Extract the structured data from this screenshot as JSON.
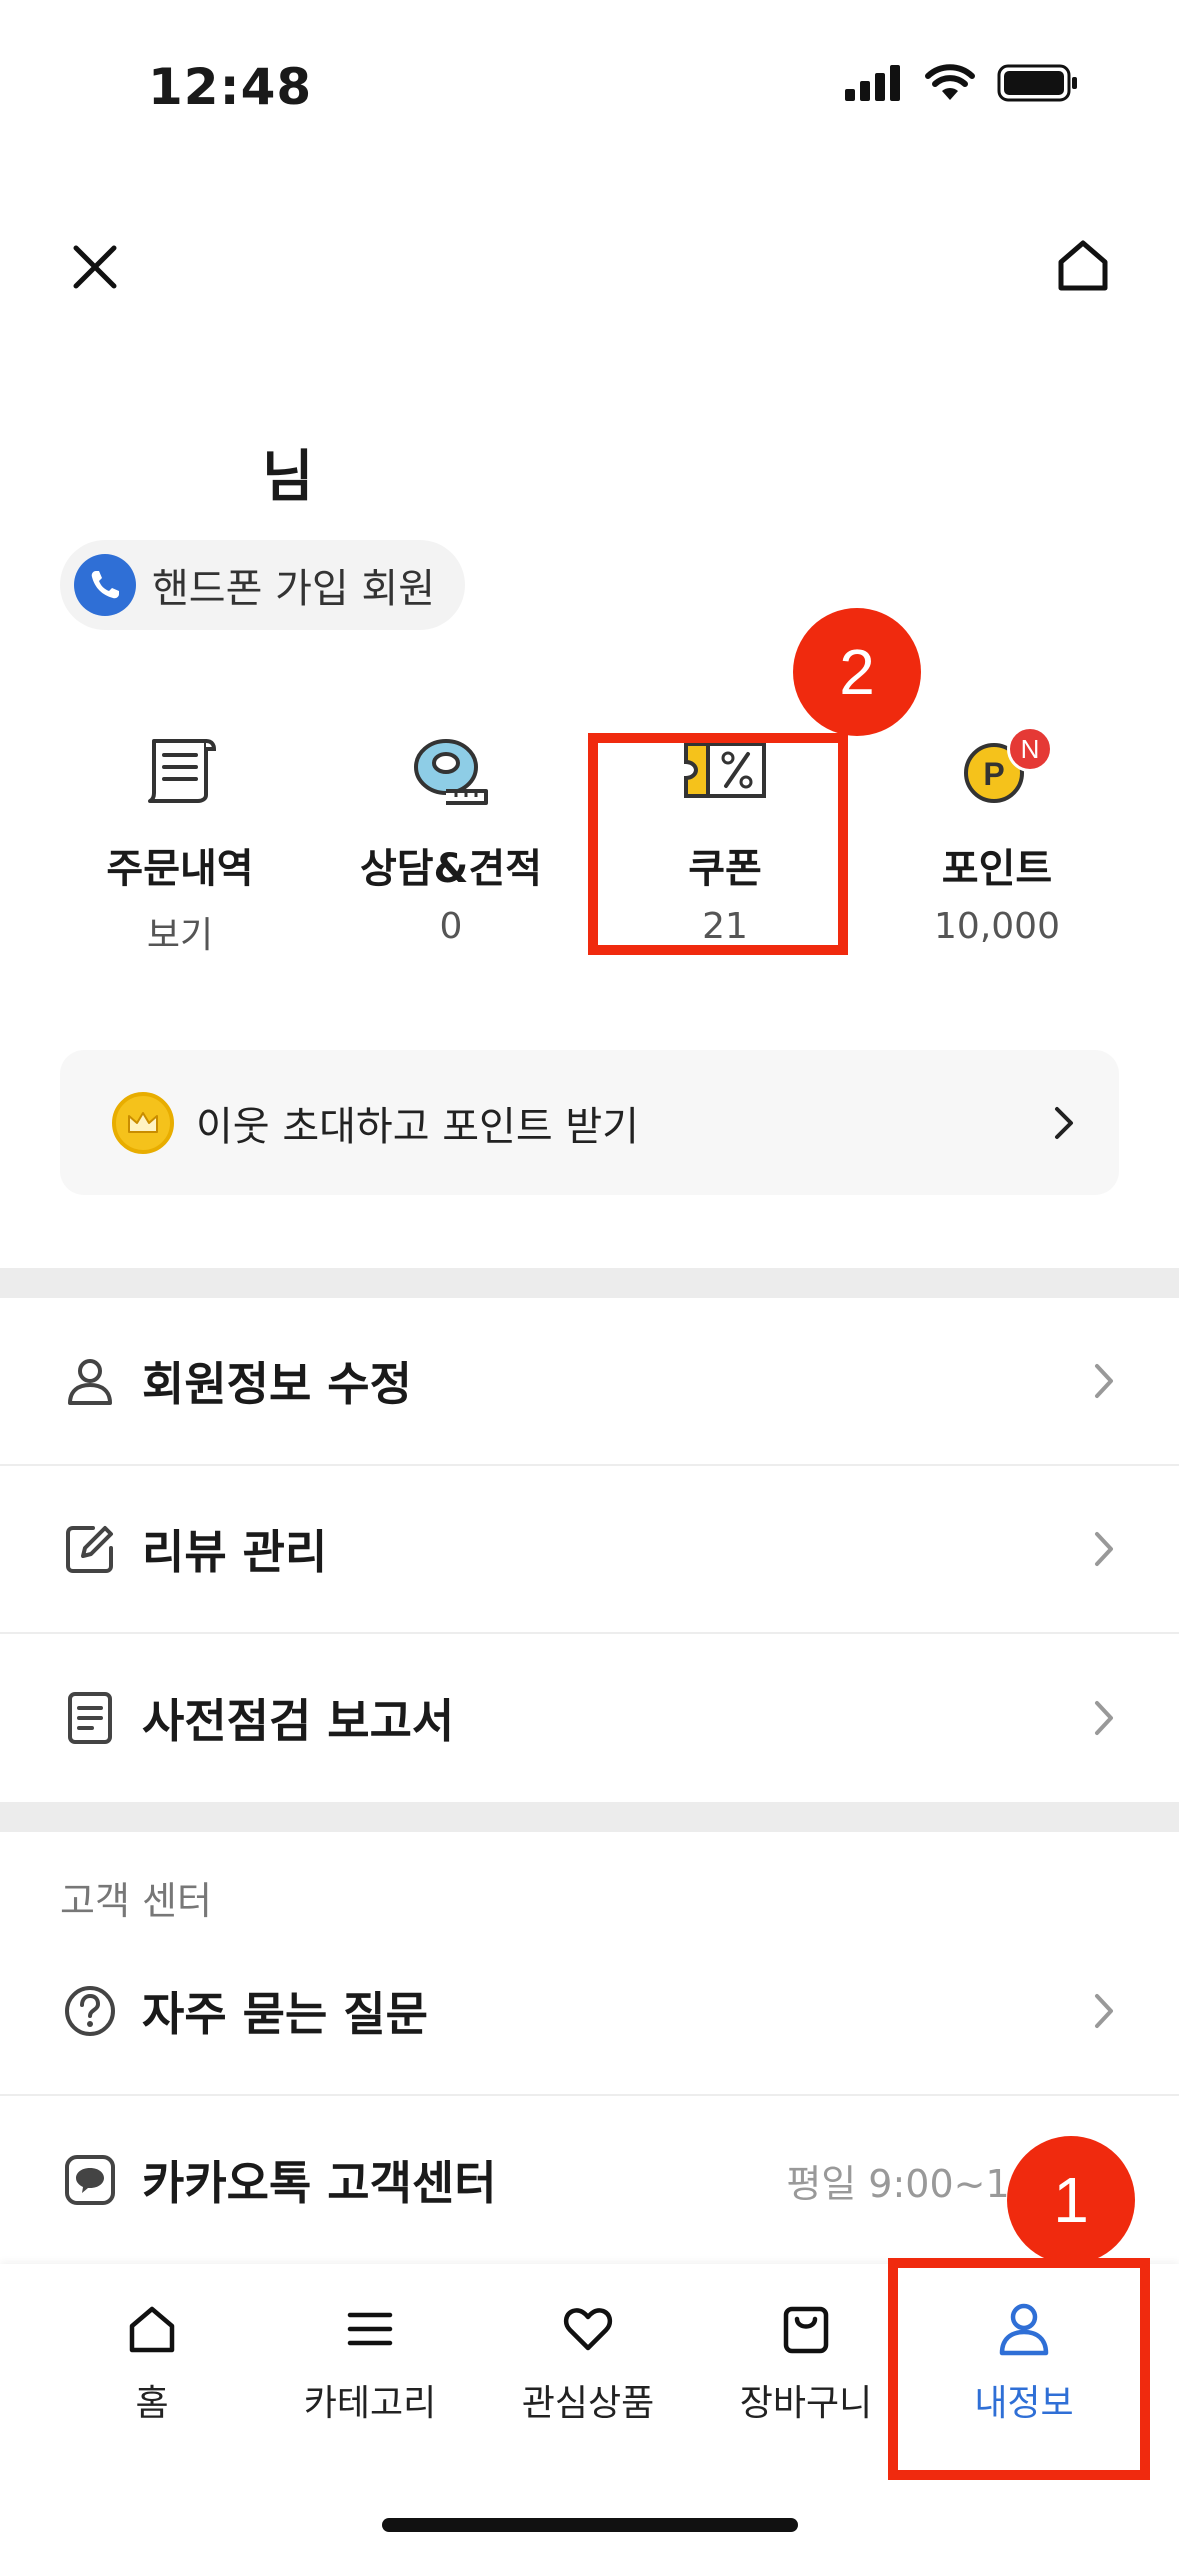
{
  "status_bar": {
    "time": "12:48"
  },
  "user": {
    "greeting_suffix": "님",
    "membership_label": "핸드폰 가입 회원"
  },
  "summary": [
    {
      "title": "주문내역",
      "value": "보기",
      "icon": "receipt-icon"
    },
    {
      "title": "상담&견적",
      "value": "0",
      "icon": "tape-measure-icon"
    },
    {
      "title": "쿠폰",
      "value": "21",
      "icon": "coupon-icon"
    },
    {
      "title": "포인트",
      "value": "10,000",
      "icon": "point-coin-icon",
      "badge": "N"
    }
  ],
  "invite_banner": {
    "text": "이웃 초대하고 포인트 받기"
  },
  "menu": [
    {
      "label": "회원정보 수정",
      "icon": "person-icon"
    },
    {
      "label": "리뷰 관리",
      "icon": "edit-icon"
    },
    {
      "label": "사전점검 보고서",
      "icon": "document-icon"
    }
  ],
  "customer_center": {
    "section_label": "고객 센터",
    "items": [
      {
        "label": "자주 묻는 질문",
        "icon": "question-icon"
      },
      {
        "label": "카카오톡 고객센터",
        "icon": "chat-icon",
        "sub": "평일 9:00~18:00"
      }
    ]
  },
  "tabbar": [
    {
      "label": "홈",
      "icon": "home-icon"
    },
    {
      "label": "카테고리",
      "icon": "menu-icon"
    },
    {
      "label": "관심상품",
      "icon": "heart-icon"
    },
    {
      "label": "장바구니",
      "icon": "bag-icon"
    },
    {
      "label": "내정보",
      "icon": "user-icon",
      "active": true
    }
  ],
  "annotations": [
    {
      "number": "1",
      "target": "tab-my-info"
    },
    {
      "number": "2",
      "target": "summary-coupon"
    }
  ],
  "colors": {
    "accent": "#2f6fd6",
    "annotation": "#f02a0e",
    "badge": "#e53935",
    "coin": "#f5c21b"
  }
}
